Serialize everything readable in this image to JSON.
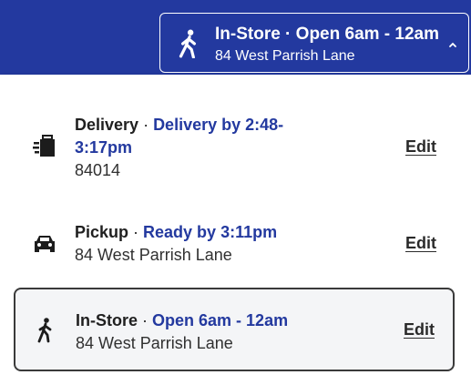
{
  "header": {
    "store_title": "In-Store · Open 6am - 12am",
    "store_address": "84 West Parrish Lane"
  },
  "options": [
    {
      "name": "Delivery",
      "separator": " · ",
      "status": "Delivery by 2:48-3:17pm",
      "detail": "84014",
      "edit_label": "Edit",
      "icon": "delivery-bag-icon"
    },
    {
      "name": "Pickup",
      "separator": " · ",
      "status": "Ready by 3:11pm",
      "detail": "84 West Parrish Lane",
      "edit_label": "Edit",
      "icon": "car-icon"
    },
    {
      "name": "In-Store",
      "separator": " · ",
      "status": "Open 6am - 12am",
      "detail": "84 West Parrish Lane",
      "edit_label": "Edit",
      "icon": "walking-person-icon",
      "selected": true
    }
  ],
  "colors": {
    "brand_blue": "#23399f",
    "selected_bg": "#f4f5f7",
    "text": "#202020"
  }
}
